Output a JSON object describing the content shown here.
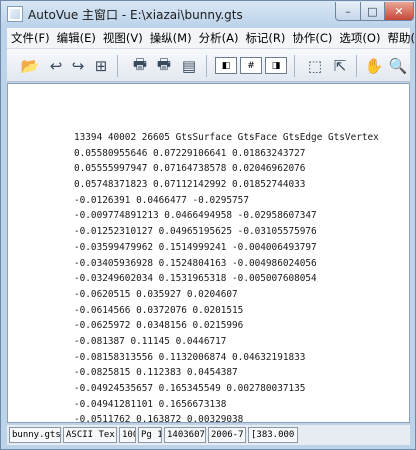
{
  "window": {
    "title": "AutoVue 主窗口 - E:\\xiazai\\bunny.gts",
    "min_glyph": "–",
    "max_glyph": "□",
    "close_glyph": "✕"
  },
  "menu": {
    "items": [
      {
        "label": "文件(F)"
      },
      {
        "label": "编辑(E)"
      },
      {
        "label": "视图(V)"
      },
      {
        "label": "操纵(M)"
      },
      {
        "label": "分析(A)"
      },
      {
        "label": "标记(R)"
      },
      {
        "label": "协作(C)"
      },
      {
        "label": "选项(O)"
      },
      {
        "label": "帮助(H)"
      }
    ]
  },
  "toolbar": {
    "open_glyph": "📂",
    "undo_glyph": "↩",
    "redo_glyph": "↪",
    "tree_glyph": "⊞",
    "print_glyph": "🖶",
    "print_preview_glyph": "🖶",
    "scan_glyph": "▤",
    "page_prev_glyph": "◧",
    "page_num_glyph": "#",
    "page_next_glyph": "◨",
    "zoom_fit_glyph": "⬚",
    "select_glyph": "⇱",
    "pan_glyph": "✋",
    "zoom_glyph": "🔍"
  },
  "document": {
    "lines": [
      "13394 40002 26605 GtsSurface GtsFace GtsEdge GtsVertex",
      "0.05580955646 0.07229106641 0.01863243727",
      "0.05555997947 0.07164738578 0.02046962076",
      "0.05748371823 0.07112142992 0.01852744033",
      "-0.0126391 0.0466477 -0.0295757",
      "-0.009774891213 0.0466494958 -0.02958607347",
      "-0.01252310127 0.04965195625 -0.03105575976",
      "-0.03599479962 0.1514999241 -0.004006493797",
      "-0.03405936928 0.1524804163 -0.004986024056",
      "-0.03249602034 0.1531965318 -0.005007608054",
      "-0.0620515 0.035927 0.0204607",
      "-0.0614566 0.0372076 0.0201515",
      "-0.0625972 0.0348156 0.0215996",
      "-0.081387 0.11145 0.0446717",
      "-0.08158313556 0.1132006874 0.04632191833",
      "-0.0825815 0.112383 0.0454387",
      "-0.04924535657 0.165345549 0.002780037135",
      "-0.04941281101 0.1656673138",
      "-0.0511762 0.163872 0.00329038"
    ]
  },
  "statusbar": {
    "filename": "bunny.gts",
    "format": "ASCII Tex",
    "zoom": "100",
    "page": "Pg 1",
    "size": "1403607",
    "date": "2006-7-",
    "coords": "[383.000"
  }
}
